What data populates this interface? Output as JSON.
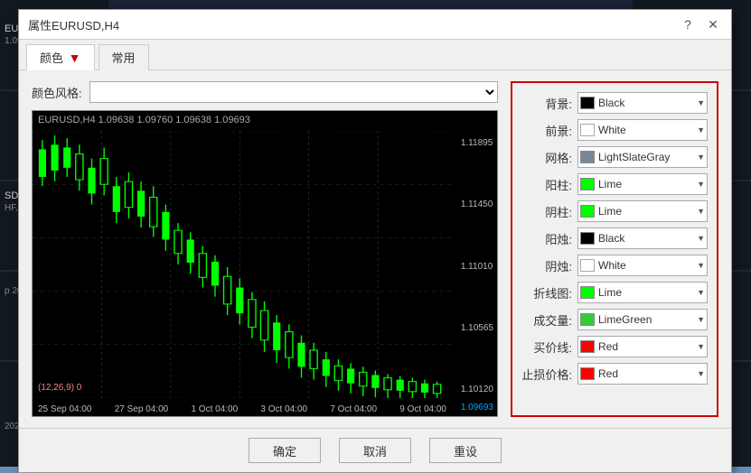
{
  "dialog": {
    "title": "属性EURUSD,H4",
    "help_btn": "?",
    "close_btn": "✕"
  },
  "tabs": [
    {
      "label": "颜色",
      "active": true
    },
    {
      "label": "常用",
      "active": false
    }
  ],
  "color_style": {
    "label": "颜色风格:",
    "placeholder": "",
    "options": []
  },
  "chart_preview": {
    "header": "EURUSD,H4 1.09638 1.09760 1.09638 1.09693",
    "prices": [
      "1.11895",
      "1.11450",
      "1.11010",
      "1.10565",
      "1.10120",
      "1.09693"
    ],
    "times": [
      "25 Sep 04:00",
      "27 Sep 04:00",
      "1 Oct 04:00",
      "3 Oct 04:00",
      "7 Oct 04:00",
      "9 Oct 04:00"
    ],
    "ma_label": "(12,26,9) 0"
  },
  "properties": [
    {
      "label": "背景:",
      "color": "#000000",
      "color_name": "Black",
      "swatch_border": "#555"
    },
    {
      "label": "前景:",
      "color": "#ffffff",
      "color_name": "White",
      "swatch_border": "#aaa"
    },
    {
      "label": "网格:",
      "color": "#778899",
      "color_name": "LightSlateGray",
      "swatch_border": "#666"
    },
    {
      "label": "阳柱:",
      "color": "#00ff00",
      "color_name": "Lime",
      "swatch_border": "#0a0"
    },
    {
      "label": "阴柱:",
      "color": "#00ff00",
      "color_name": "Lime",
      "swatch_border": "#0a0"
    },
    {
      "label": "阳烛:",
      "color": "#000000",
      "color_name": "Black",
      "swatch_border": "#555"
    },
    {
      "label": "阴烛:",
      "color": "#ffffff",
      "color_name": "White",
      "swatch_border": "#aaa"
    },
    {
      "label": "折线图:",
      "color": "#00ff00",
      "color_name": "Lime",
      "swatch_border": "#0a0"
    },
    {
      "label": "成交量:",
      "color": "#32cd32",
      "color_name": "LimeGreen",
      "swatch_border": "#0a0"
    },
    {
      "label": "买价线:",
      "color": "#ff0000",
      "color_name": "Red",
      "swatch_border": "#a00"
    },
    {
      "label": "止损价格:",
      "color": "#ff0000",
      "color_name": "Red",
      "swatch_border": "#a00"
    }
  ],
  "footer": {
    "confirm": "确定",
    "cancel": "取消",
    "reset": "重设"
  }
}
